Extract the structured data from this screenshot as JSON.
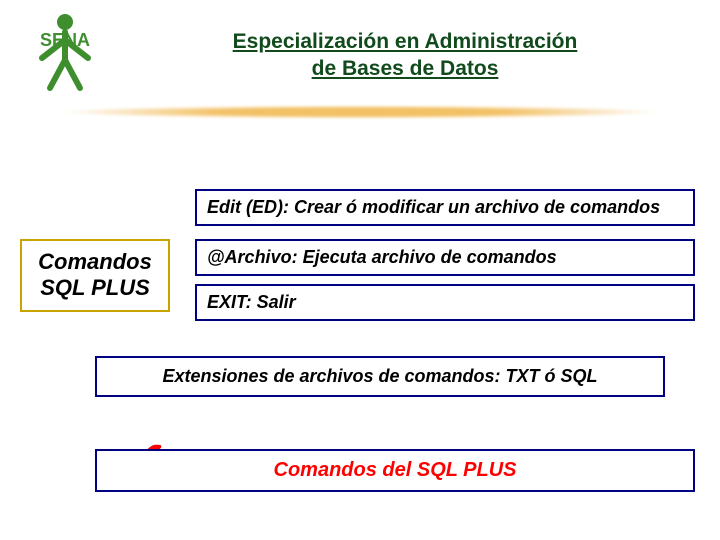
{
  "header": {
    "logo_name": "SENA",
    "title_line1": "Especialización en Administración",
    "title_line2": "de Bases de Datos"
  },
  "sidebar": {
    "label_line1": "Comandos",
    "label_line2": "SQL PLUS"
  },
  "commands": {
    "item1": "Edit (ED): Crear ó modificar un archivo de comandos",
    "item2": "@Archivo: Ejecuta archivo de comandos",
    "item3": "EXIT: Salir"
  },
  "extensions": "Extensiones de archivos de comandos: TXT ó SQL",
  "footer": "Comandos del SQL PLUS",
  "colors": {
    "brand_green": "#3E8E2E",
    "title_green": "#114B1C",
    "box_border": "#000080",
    "label_border": "#C9A400",
    "brush": "#F2C166",
    "accent_red": "#FF0000"
  }
}
